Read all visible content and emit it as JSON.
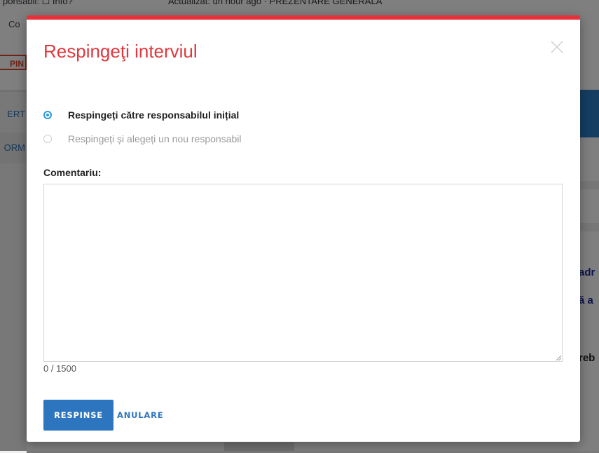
{
  "background": {
    "top_left_text": "ponsabil: ☐ Info?",
    "top_mid_text": "Actualizat: un hour ago · PREZENTARE GENERALĂ",
    "left_label_1": "Co",
    "left_tag": "PIN",
    "left_rows": [
      "ERT",
      "ORM"
    ],
    "right_texts": [
      "adr",
      "ă a",
      "reb"
    ]
  },
  "modal": {
    "title": "Respingeţi interviul",
    "close_label": "×",
    "options": [
      {
        "label": "Respingeți către responsabilul inițial",
        "checked": true
      },
      {
        "label": "Respingeți și alegeți un nou responsabil",
        "checked": false
      }
    ],
    "comment": {
      "label": "Comentariu:",
      "value": "",
      "counter": "0 / 1500"
    },
    "buttons": {
      "reject": "RESPINSE",
      "cancel": "ANULARE"
    }
  },
  "colors": {
    "accent_red": "#e5323a",
    "primary_blue": "#2d76bf",
    "radio_blue": "#2f9ae0"
  }
}
